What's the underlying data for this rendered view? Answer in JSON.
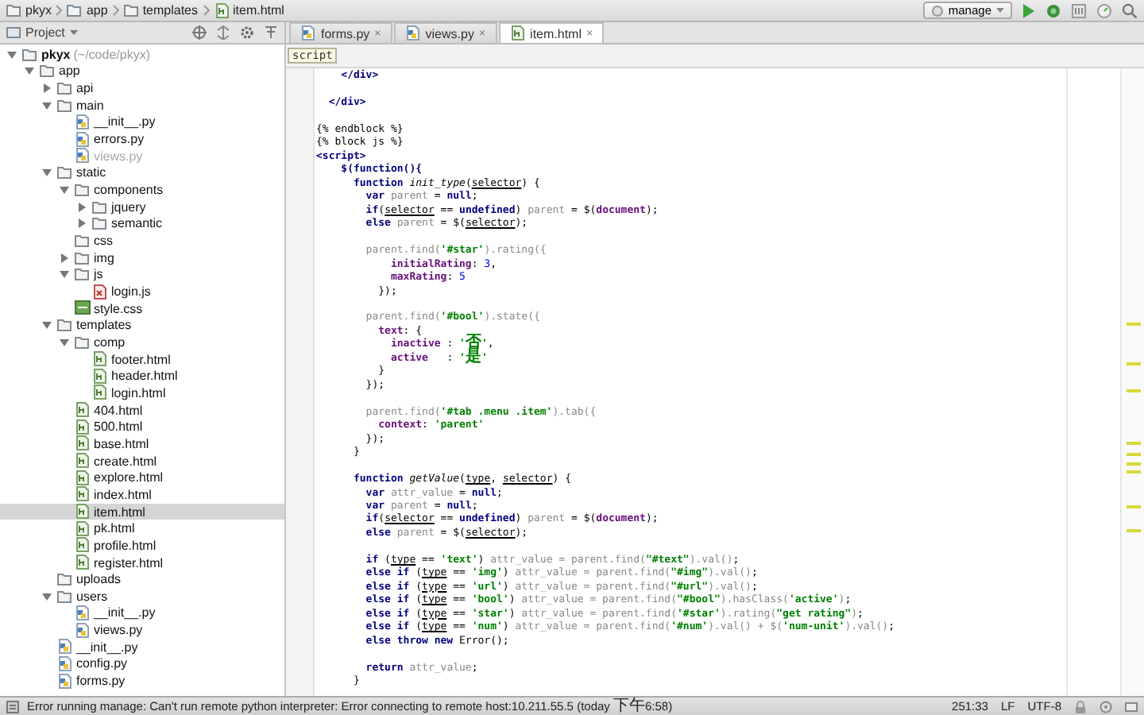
{
  "breadcrumbs": [
    {
      "label": "pkyx",
      "kind": "folder"
    },
    {
      "label": "app",
      "kind": "folder"
    },
    {
      "label": "templates",
      "kind": "folder"
    },
    {
      "label": "item.html",
      "kind": "html"
    }
  ],
  "run_config": {
    "label": "manage"
  },
  "project_panel": {
    "label": "Project"
  },
  "tabs": [
    {
      "label": "forms.py",
      "kind": "py",
      "selected": false,
      "close": "×"
    },
    {
      "label": "views.py",
      "kind": "py",
      "selected": false,
      "close": "×"
    },
    {
      "label": "item.html",
      "kind": "html",
      "selected": true,
      "close": "×"
    }
  ],
  "tree": [
    {
      "name": "pkyx",
      "note": "(~/code/pkyx)",
      "kind": "root",
      "expanded": true,
      "selected": false,
      "greyed": false,
      "children": [
        {
          "name": "app",
          "kind": "folder",
          "expanded": true,
          "selected": false,
          "greyed": false,
          "children": [
            {
              "name": "api",
              "kind": "folder",
              "expanded": false,
              "selected": false,
              "greyed": false
            },
            {
              "name": "main",
              "kind": "folder",
              "expanded": true,
              "selected": false,
              "greyed": false,
              "children": [
                {
                  "name": "__init__.py",
                  "kind": "py",
                  "selected": false,
                  "greyed": false
                },
                {
                  "name": "errors.py",
                  "kind": "py",
                  "selected": false,
                  "greyed": false
                },
                {
                  "name": "views.py",
                  "kind": "py",
                  "selected": false,
                  "greyed": true
                }
              ]
            },
            {
              "name": "static",
              "kind": "folder",
              "expanded": true,
              "selected": false,
              "greyed": false,
              "children": [
                {
                  "name": "components",
                  "kind": "folder",
                  "expanded": true,
                  "selected": false,
                  "greyed": false,
                  "children": [
                    {
                      "name": "jquery",
                      "kind": "folder",
                      "expanded": false,
                      "selected": false,
                      "greyed": false
                    },
                    {
                      "name": "semantic",
                      "kind": "folder",
                      "expanded": false,
                      "selected": false,
                      "greyed": false
                    }
                  ]
                },
                {
                  "name": "css",
                  "kind": "folder",
                  "selected": false,
                  "greyed": false
                },
                {
                  "name": "img",
                  "kind": "folder",
                  "expanded": false,
                  "selected": false,
                  "greyed": false
                },
                {
                  "name": "js",
                  "kind": "folder",
                  "expanded": true,
                  "selected": false,
                  "greyed": false,
                  "children": [
                    {
                      "name": "login.js",
                      "kind": "js",
                      "selected": false,
                      "greyed": false
                    }
                  ]
                },
                {
                  "name": "style.css",
                  "kind": "css",
                  "selected": false,
                  "greyed": false
                }
              ]
            },
            {
              "name": "templates",
              "kind": "folder",
              "expanded": true,
              "selected": false,
              "greyed": false,
              "children": [
                {
                  "name": "comp",
                  "kind": "folder",
                  "expanded": true,
                  "selected": false,
                  "greyed": false,
                  "children": [
                    {
                      "name": "footer.html",
                      "kind": "html",
                      "selected": false,
                      "greyed": false
                    },
                    {
                      "name": "header.html",
                      "kind": "html",
                      "selected": false,
                      "greyed": false
                    },
                    {
                      "name": "login.html",
                      "kind": "html",
                      "selected": false,
                      "greyed": false
                    }
                  ]
                },
                {
                  "name": "404.html",
                  "kind": "html",
                  "selected": false,
                  "greyed": false
                },
                {
                  "name": "500.html",
                  "kind": "html",
                  "selected": false,
                  "greyed": false
                },
                {
                  "name": "base.html",
                  "kind": "html",
                  "selected": false,
                  "greyed": false
                },
                {
                  "name": "create.html",
                  "kind": "html",
                  "selected": false,
                  "greyed": false
                },
                {
                  "name": "explore.html",
                  "kind": "html",
                  "selected": false,
                  "greyed": false
                },
                {
                  "name": "index.html",
                  "kind": "html",
                  "selected": false,
                  "greyed": false
                },
                {
                  "name": "item.html",
                  "kind": "html",
                  "selected": true,
                  "greyed": false
                },
                {
                  "name": "pk.html",
                  "kind": "html",
                  "selected": false,
                  "greyed": false
                },
                {
                  "name": "profile.html",
                  "kind": "html",
                  "selected": false,
                  "greyed": false
                },
                {
                  "name": "register.html",
                  "kind": "html",
                  "selected": false,
                  "greyed": false
                }
              ]
            },
            {
              "name": "uploads",
              "kind": "folder",
              "selected": false,
              "greyed": false
            },
            {
              "name": "users",
              "kind": "folder",
              "expanded": true,
              "selected": false,
              "greyed": false,
              "children": [
                {
                  "name": "__init__.py",
                  "kind": "py",
                  "selected": false,
                  "greyed": false
                },
                {
                  "name": "views.py",
                  "kind": "py",
                  "selected": false,
                  "greyed": false
                }
              ]
            },
            {
              "name": "__init__.py",
              "kind": "py",
              "selected": false,
              "greyed": false
            },
            {
              "name": "config.py",
              "kind": "py",
              "selected": false,
              "greyed": false
            },
            {
              "name": "forms.py",
              "kind": "py",
              "selected": false,
              "greyed": false
            }
          ]
        }
      ]
    }
  ],
  "editor": {
    "context": "script",
    "lines": [
      {
        "kind": "code",
        "tokens": [
          {
            "text": "    </div>",
            "kind": "tag"
          }
        ]
      },
      {
        "kind": "blank"
      },
      {
        "kind": "code",
        "tokens": [
          {
            "text": "  </div>",
            "kind": "tag"
          }
        ]
      },
      {
        "kind": "blank"
      },
      {
        "kind": "code",
        "tokens": [
          {
            "text": "{% endblock %}",
            "kind": "plain"
          }
        ]
      },
      {
        "kind": "code",
        "tokens": [
          {
            "text": "{% block js %}",
            "kind": "plain"
          }
        ]
      },
      {
        "kind": "code",
        "tokens": [
          {
            "text": "<script>",
            "kind": "tag"
          }
        ]
      },
      {
        "kind": "code",
        "tokens": [
          {
            "text": "    $(function(){",
            "kind": "keyword"
          }
        ]
      },
      {
        "kind": "code",
        "tokens": [
          {
            "text": "      function",
            "kind": "keyword"
          },
          {
            "text": " init_type",
            "kind": "function"
          },
          {
            "text": "(",
            "kind": "plain"
          },
          {
            "text": "selector",
            "kind": "param"
          },
          {
            "text": ") {",
            "kind": "plain"
          }
        ]
      },
      {
        "kind": "code",
        "tokens": [
          {
            "text": "        var",
            "kind": "keyword"
          },
          {
            "text": " parent",
            "kind": "local"
          },
          {
            "text": " = ",
            "kind": "plain"
          },
          {
            "text": "null",
            "kind": "keyword"
          },
          {
            "text": ";",
            "kind": "plain"
          }
        ]
      },
      {
        "kind": "code",
        "tokens": [
          {
            "text": "        if",
            "kind": "keyword"
          },
          {
            "text": "(",
            "kind": "plain"
          },
          {
            "text": "selector",
            "kind": "param"
          },
          {
            "text": " == ",
            "kind": "plain"
          },
          {
            "text": "undefined",
            "kind": "keyword"
          },
          {
            "text": ") ",
            "kind": "plain"
          },
          {
            "text": "parent",
            "kind": "local"
          },
          {
            "text": " = $(",
            "kind": "plain"
          },
          {
            "text": "document",
            "kind": "global"
          },
          {
            "text": ");",
            "kind": "plain"
          }
        ]
      },
      {
        "kind": "code",
        "tokens": [
          {
            "text": "        else",
            "kind": "keyword"
          },
          {
            "text": " parent",
            "kind": "local"
          },
          {
            "text": " = $(",
            "kind": "plain"
          },
          {
            "text": "selector",
            "kind": "param"
          },
          {
            "text": ");",
            "kind": "plain"
          }
        ]
      },
      {
        "kind": "blank"
      },
      {
        "kind": "code",
        "tokens": [
          {
            "text": "        parent.find(",
            "kind": "local"
          },
          {
            "text": "'#star'",
            "kind": "string"
          },
          {
            "text": ").rating({",
            "kind": "local"
          }
        ]
      },
      {
        "kind": "code",
        "tokens": [
          {
            "text": "            initialRating",
            "kind": "property"
          },
          {
            "text": ": ",
            "kind": "plain"
          },
          {
            "text": "3",
            "kind": "number"
          },
          {
            "text": ",",
            "kind": "plain"
          }
        ]
      },
      {
        "kind": "code",
        "tokens": [
          {
            "text": "            maxRating",
            "kind": "property"
          },
          {
            "text": ": ",
            "kind": "plain"
          },
          {
            "text": "5",
            "kind": "number"
          }
        ]
      },
      {
        "kind": "code",
        "tokens": [
          {
            "text": "          });",
            "kind": "plain"
          }
        ]
      },
      {
        "kind": "blank"
      },
      {
        "kind": "code",
        "tokens": [
          {
            "text": "        parent.find(",
            "kind": "local"
          },
          {
            "text": "'#bool'",
            "kind": "string"
          },
          {
            "text": ").state({",
            "kind": "local"
          }
        ]
      },
      {
        "kind": "code",
        "tokens": [
          {
            "text": "          text",
            "kind": "property"
          },
          {
            "text": ": {",
            "kind": "plain"
          }
        ]
      },
      {
        "kind": "code",
        "tokens": [
          {
            "text": "            inactive",
            "kind": "property"
          },
          {
            "text": " : ",
            "kind": "plain"
          },
          {
            "text": "'否'",
            "kind": "string"
          },
          {
            "text": ",",
            "kind": "plain"
          }
        ]
      },
      {
        "kind": "code",
        "tokens": [
          {
            "text": "            active",
            "kind": "property"
          },
          {
            "text": "   : ",
            "kind": "plain"
          },
          {
            "text": "'是'",
            "kind": "string"
          }
        ]
      },
      {
        "kind": "code",
        "tokens": [
          {
            "text": "          }",
            "kind": "plain"
          }
        ]
      },
      {
        "kind": "code",
        "tokens": [
          {
            "text": "        });",
            "kind": "plain"
          }
        ]
      },
      {
        "kind": "blank"
      },
      {
        "kind": "code",
        "tokens": [
          {
            "text": "        parent.find(",
            "kind": "local"
          },
          {
            "text": "'#tab .menu .item'",
            "kind": "string"
          },
          {
            "text": ").tab({",
            "kind": "local"
          }
        ]
      },
      {
        "kind": "code",
        "tokens": [
          {
            "text": "          context",
            "kind": "property"
          },
          {
            "text": ": ",
            "kind": "plain"
          },
          {
            "text": "'parent'",
            "kind": "string"
          }
        ]
      },
      {
        "kind": "code",
        "tokens": [
          {
            "text": "        });",
            "kind": "plain"
          }
        ]
      },
      {
        "kind": "code",
        "tokens": [
          {
            "text": "      }",
            "kind": "plain"
          }
        ]
      },
      {
        "kind": "blank"
      },
      {
        "kind": "code",
        "tokens": [
          {
            "text": "      function",
            "kind": "keyword"
          },
          {
            "text": " getValue",
            "kind": "function"
          },
          {
            "text": "(",
            "kind": "plain"
          },
          {
            "text": "type",
            "kind": "param"
          },
          {
            "text": ", ",
            "kind": "plain"
          },
          {
            "text": "selector",
            "kind": "param"
          },
          {
            "text": ") {",
            "kind": "plain"
          }
        ]
      },
      {
        "kind": "code",
        "tokens": [
          {
            "text": "        var",
            "kind": "keyword"
          },
          {
            "text": " attr_value",
            "kind": "local"
          },
          {
            "text": " = ",
            "kind": "plain"
          },
          {
            "text": "null",
            "kind": "keyword"
          },
          {
            "text": ";",
            "kind": "plain"
          }
        ]
      },
      {
        "kind": "code",
        "tokens": [
          {
            "text": "        var",
            "kind": "keyword"
          },
          {
            "text": " parent",
            "kind": "local"
          },
          {
            "text": " = ",
            "kind": "plain"
          },
          {
            "text": "null",
            "kind": "keyword"
          },
          {
            "text": ";",
            "kind": "plain"
          }
        ]
      },
      {
        "kind": "code",
        "tokens": [
          {
            "text": "        if",
            "kind": "keyword"
          },
          {
            "text": "(",
            "kind": "plain"
          },
          {
            "text": "selector",
            "kind": "param"
          },
          {
            "text": " == ",
            "kind": "plain"
          },
          {
            "text": "undefined",
            "kind": "keyword"
          },
          {
            "text": ") ",
            "kind": "plain"
          },
          {
            "text": "parent",
            "kind": "local"
          },
          {
            "text": " = $(",
            "kind": "plain"
          },
          {
            "text": "document",
            "kind": "global"
          },
          {
            "text": ");",
            "kind": "plain"
          }
        ]
      },
      {
        "kind": "code",
        "tokens": [
          {
            "text": "        else",
            "kind": "keyword"
          },
          {
            "text": " parent",
            "kind": "local"
          },
          {
            "text": " = $(",
            "kind": "plain"
          },
          {
            "text": "selector",
            "kind": "param"
          },
          {
            "text": ");",
            "kind": "plain"
          }
        ]
      },
      {
        "kind": "blank"
      },
      {
        "kind": "code",
        "tokens": [
          {
            "text": "        if",
            "kind": "keyword"
          },
          {
            "text": " (",
            "kind": "plain"
          },
          {
            "text": "type",
            "kind": "param"
          },
          {
            "text": " == ",
            "kind": "plain"
          },
          {
            "text": "'text'",
            "kind": "string"
          },
          {
            "text": ") ",
            "kind": "plain"
          },
          {
            "text": "attr_value = parent.find(",
            "kind": "local"
          },
          {
            "text": "\"#text\"",
            "kind": "string"
          },
          {
            "text": ").val()",
            "kind": "local"
          },
          {
            "text": ";",
            "kind": "plain"
          }
        ]
      },
      {
        "kind": "code",
        "tokens": [
          {
            "text": "        else if",
            "kind": "keyword"
          },
          {
            "text": " (",
            "kind": "plain"
          },
          {
            "text": "type",
            "kind": "param"
          },
          {
            "text": " == ",
            "kind": "plain"
          },
          {
            "text": "'img'",
            "kind": "string"
          },
          {
            "text": ") ",
            "kind": "plain"
          },
          {
            "text": "attr_value = parent.find(",
            "kind": "local"
          },
          {
            "text": "\"#img\"",
            "kind": "string"
          },
          {
            "text": ").val()",
            "kind": "local"
          },
          {
            "text": ";",
            "kind": "plain"
          }
        ]
      },
      {
        "kind": "code",
        "tokens": [
          {
            "text": "        else if",
            "kind": "keyword"
          },
          {
            "text": " (",
            "kind": "plain"
          },
          {
            "text": "type",
            "kind": "param"
          },
          {
            "text": " == ",
            "kind": "plain"
          },
          {
            "text": "'url'",
            "kind": "string"
          },
          {
            "text": ") ",
            "kind": "plain"
          },
          {
            "text": "attr_value = parent.find(",
            "kind": "local"
          },
          {
            "text": "\"#url\"",
            "kind": "string"
          },
          {
            "text": ").val()",
            "kind": "local"
          },
          {
            "text": ";",
            "kind": "plain"
          }
        ]
      },
      {
        "kind": "code",
        "tokens": [
          {
            "text": "        else if",
            "kind": "keyword"
          },
          {
            "text": " (",
            "kind": "plain"
          },
          {
            "text": "type",
            "kind": "param"
          },
          {
            "text": " == ",
            "kind": "plain"
          },
          {
            "text": "'bool'",
            "kind": "string"
          },
          {
            "text": ") ",
            "kind": "plain"
          },
          {
            "text": "attr_value = parent.find(",
            "kind": "local"
          },
          {
            "text": "\"#bool\"",
            "kind": "string"
          },
          {
            "text": ").hasClass(",
            "kind": "local"
          },
          {
            "text": "'active'",
            "kind": "string"
          },
          {
            "text": ")",
            "kind": "local"
          },
          {
            "text": ";",
            "kind": "plain"
          }
        ]
      },
      {
        "kind": "code",
        "tokens": [
          {
            "text": "        else if",
            "kind": "keyword"
          },
          {
            "text": " (",
            "kind": "plain"
          },
          {
            "text": "type",
            "kind": "param"
          },
          {
            "text": " == ",
            "kind": "plain"
          },
          {
            "text": "'star'",
            "kind": "string"
          },
          {
            "text": ") ",
            "kind": "plain"
          },
          {
            "text": "attr_value = parent.find(",
            "kind": "local"
          },
          {
            "text": "'#star'",
            "kind": "string"
          },
          {
            "text": ").rating(",
            "kind": "local"
          },
          {
            "text": "\"get rating\"",
            "kind": "string"
          },
          {
            "text": ")",
            "kind": "local"
          },
          {
            "text": ";",
            "kind": "plain"
          }
        ]
      },
      {
        "kind": "code",
        "tokens": [
          {
            "text": "        else if",
            "kind": "keyword"
          },
          {
            "text": " (",
            "kind": "plain"
          },
          {
            "text": "type",
            "kind": "param"
          },
          {
            "text": " == ",
            "kind": "plain"
          },
          {
            "text": "'num'",
            "kind": "string"
          },
          {
            "text": ") ",
            "kind": "plain"
          },
          {
            "text": "attr_value = parent.find(",
            "kind": "local"
          },
          {
            "text": "'#num'",
            "kind": "string"
          },
          {
            "text": ").val() + $(",
            "kind": "local"
          },
          {
            "text": "'num-unit'",
            "kind": "string"
          },
          {
            "text": ").val()",
            "kind": "local"
          },
          {
            "text": ";",
            "kind": "plain"
          }
        ]
      },
      {
        "kind": "code",
        "tokens": [
          {
            "text": "        else throw new",
            "kind": "keyword"
          },
          {
            "text": " Error();",
            "kind": "plain"
          }
        ]
      },
      {
        "kind": "blank"
      },
      {
        "kind": "code",
        "tokens": [
          {
            "text": "        return",
            "kind": "keyword"
          },
          {
            "text": " attr_value",
            "kind": "local"
          },
          {
            "text": ";",
            "kind": "plain"
          }
        ]
      },
      {
        "kind": "code",
        "tokens": [
          {
            "text": "      }",
            "kind": "plain"
          }
        ]
      }
    ]
  },
  "status_bar": {
    "message": "Error running manage: Can't run remote python interpreter: Error connecting to remote host:10.211.55.5 (today 下午6:58)",
    "position": "251:33",
    "line_separator": "LF",
    "encoding": "UTF-8"
  }
}
